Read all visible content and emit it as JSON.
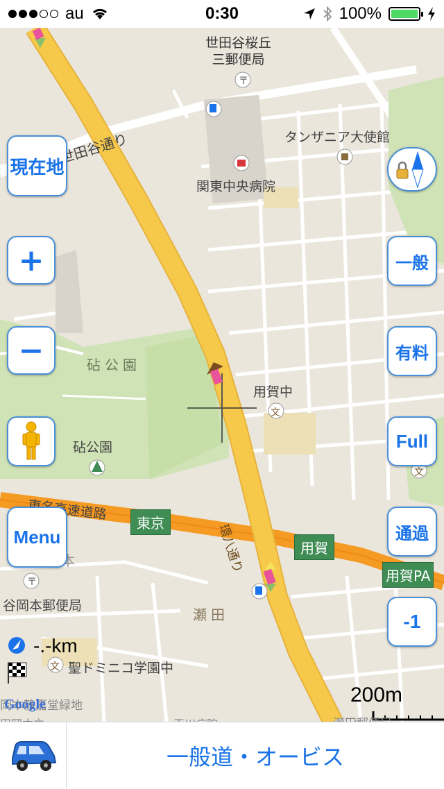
{
  "status_bar": {
    "carrier": "au",
    "time": "0:30",
    "battery": "100%",
    "signal_bars_filled": 3,
    "signal_bars_total": 5
  },
  "map": {
    "labels": {
      "post_office_top_line1": "世田谷桜丘",
      "post_office_top_line2": "三郵便局",
      "road_setagaya": "世田谷通り",
      "tanzania_embassy": "タンザニア大使館",
      "kanto_hospital": "関東中央病院",
      "kinuta_park_big": "砧公園",
      "kinuta_park": "砧公園",
      "yoga_junior_high": "用賀中",
      "tomei_expressway": "東名高速道路",
      "kanpachi": "環八通り",
      "okamoto": "岡本",
      "okamoto_post": "谷岡本郵便局",
      "seta": "瀬田",
      "dominican": "聖ドミニコ学園中",
      "bottom_left_post": "岡本静嘉堂緑地",
      "bottom_right_post": "瀬田郵便局",
      "bottom_strip_left": "田岡本立",
      "bottom_strip_mid": "玉川病院"
    },
    "green_labels": {
      "tokyo": "東京",
      "yoga": "用賀",
      "yoga_pa": "用賀PA"
    },
    "distance": "-.-km",
    "scale": "200m",
    "google_logo": "Google"
  },
  "buttons": {
    "current_location": "現在地",
    "zoom_in": "+",
    "zoom_out": "−",
    "menu": "Menu",
    "general": "一般",
    "toll": "有料",
    "full": "Full",
    "pass": "通過",
    "minus_one": "-1"
  },
  "bottom_bar": {
    "mode_label": "一般道・オービス"
  },
  "colors": {
    "accent": "#1a73e8",
    "road_main": "#f7c94a",
    "expressway": "#f59a23",
    "park": "#cfe3b6"
  }
}
